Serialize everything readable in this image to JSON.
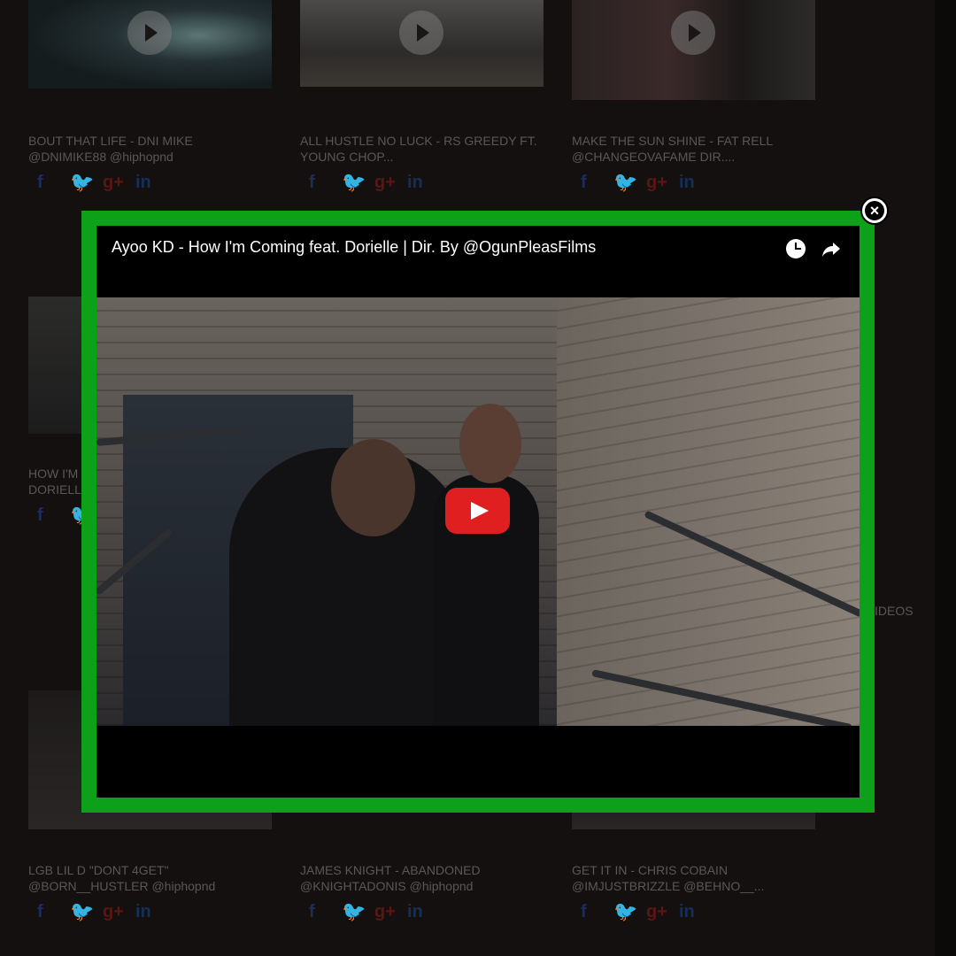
{
  "background_cards": {
    "top_row": [
      {
        "title_line1": "BOUT THAT LIFE - DNI MIKE",
        "title_line2": "@DNIMIKE88 @hiphopnd"
      },
      {
        "title_line1": "ALL HUSTLE NO LUCK - RS GREEDY FT.",
        "title_line2": "YOUNG CHOP..."
      },
      {
        "title_line1": "MAKE THE SUN SHINE - FAT RELL",
        "title_line2": "@CHANGEOVAFAME DIR...."
      }
    ],
    "middle_left": {
      "title_line1": "HOW I'M",
      "title_line2": "DORIELL"
    },
    "middle_right_text": "IDEOS",
    "bottom_row": [
      {
        "title_line1": "LGB LIL D \"DONT 4GET\"",
        "title_line2": "@BORN__HUSTLER @hiphopnd"
      },
      {
        "title_line1": "JAMES KNIGHT - ABANDONED",
        "title_line2": "@KNIGHTADONIS @hiphopnd"
      },
      {
        "title_line1": "GET IT IN - CHRIS COBAIN",
        "title_line2": "@IMJUSTBRIZZLE @BEHNO__..."
      }
    ],
    "social_icons": {
      "facebook": "f",
      "twitter": "twitter-bird-icon",
      "google_plus": "g+",
      "linkedin": "in"
    }
  },
  "modal": {
    "video_title": "Ayoo KD - How I'm Coming feat. Dorielle | Dir. By @OgunPleasFilms",
    "close_label": "×",
    "icons": [
      "clock-icon",
      "share-icon",
      "youtube-play-icon"
    ],
    "accent_color": "#0da11a"
  }
}
